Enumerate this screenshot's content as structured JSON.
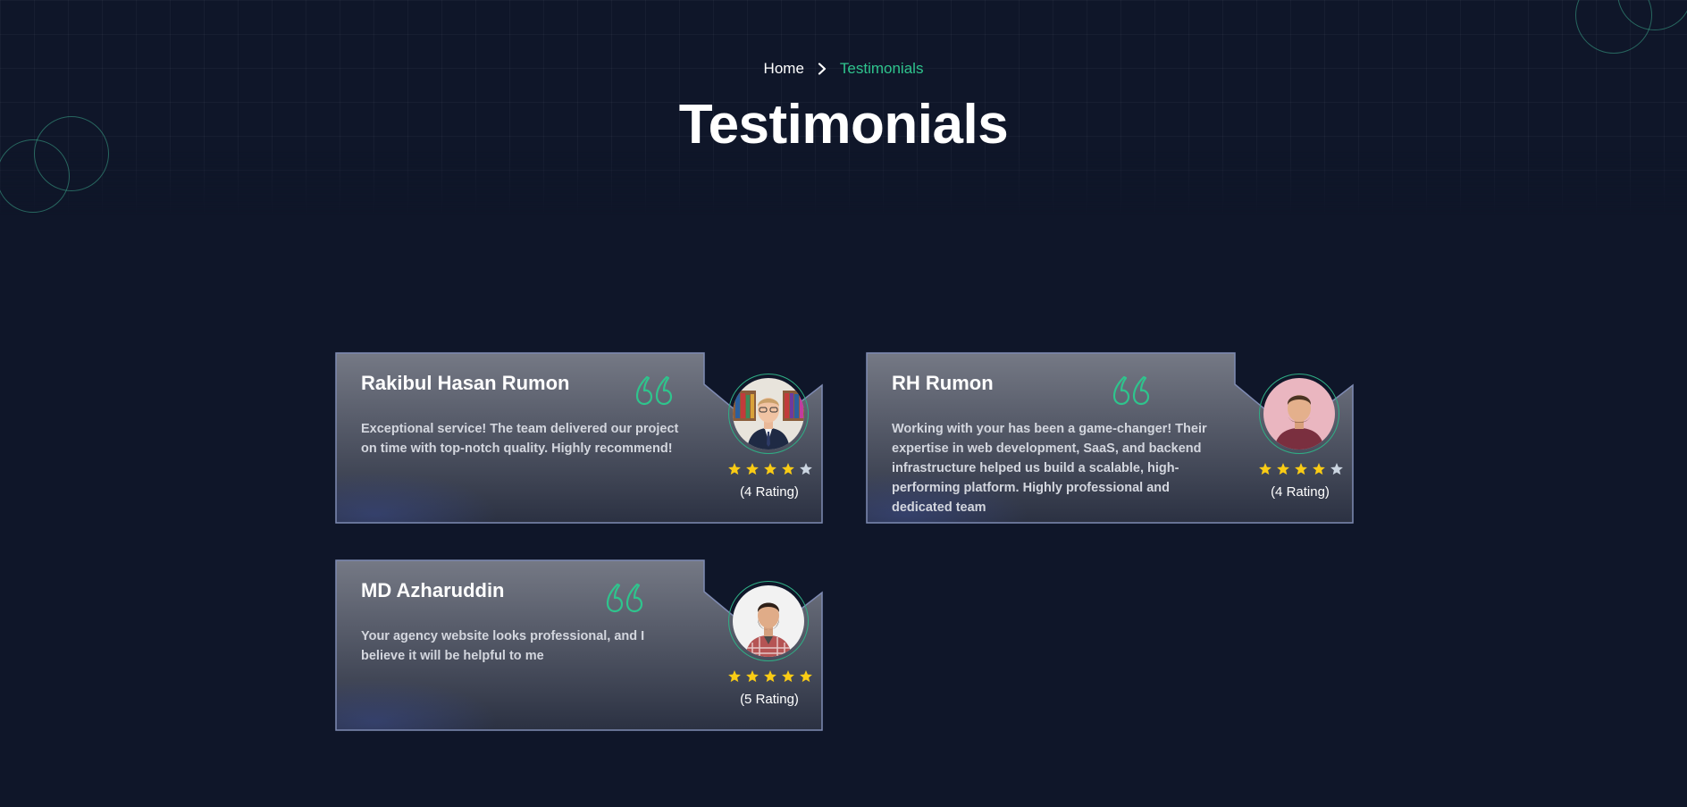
{
  "breadcrumb": {
    "home": "Home",
    "current": "Testimonials"
  },
  "page": {
    "title": "Testimonials"
  },
  "colors": {
    "background": "#0f1629",
    "accent": "#2fc48d",
    "star": "#facc15",
    "star_empty": "#cbd5e1"
  },
  "icons": {
    "chevron": "chevron-right-icon",
    "quote": "quote-icon",
    "star": "star-icon"
  },
  "testimonials": [
    {
      "name": "Rakibul Hasan Rumon",
      "text": "Exceptional service! The team delivered our project on time with top-notch quality. Highly recommend!",
      "rating": 4,
      "rating_label": "(4 Rating)"
    },
    {
      "name": "RH Rumon",
      "text": "Working with your has been a game-changer! Their expertise in web development, SaaS, and backend infrastructure helped us build a scalable, high-performing platform. Highly professional and dedicated team",
      "rating": 4,
      "rating_label": "(4 Rating)"
    },
    {
      "name": "MD Azharuddin",
      "text": "Your agency website looks professional, and I believe it will be helpful to me",
      "rating": 5,
      "rating_label": "(5 Rating)"
    }
  ]
}
